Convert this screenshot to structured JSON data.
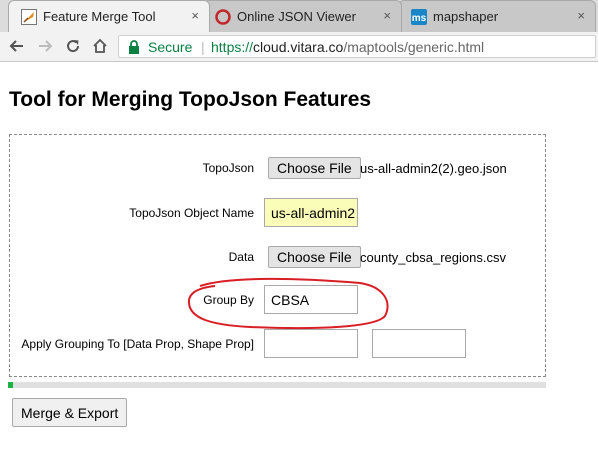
{
  "browser": {
    "tabs": [
      {
        "title": "Feature Merge Tool",
        "icon": "tool-favicon",
        "close": "×"
      },
      {
        "title": "Online JSON Viewer",
        "icon": "json-viewer-favicon",
        "close": "×"
      },
      {
        "title": "mapshaper",
        "icon": "mapshaper-favicon",
        "close": "×"
      }
    ],
    "address": {
      "secure_label": "Secure",
      "separator": "|",
      "scheme": "https://",
      "host": "cloud.vitara.co",
      "path": "/maptools/generic.html"
    }
  },
  "page": {
    "title": "Tool for Merging TopoJson Features",
    "form": {
      "topojson": {
        "label": "TopoJson",
        "button": "Choose File",
        "file": "us-all-admin2(2).geo.json"
      },
      "object_name": {
        "label": "TopoJson Object Name",
        "value": "us-all-admin2"
      },
      "data": {
        "label": "Data",
        "button": "Choose File",
        "file": "county_cbsa_regions.csv"
      },
      "group_by": {
        "label": "Group By",
        "value": "CBSA"
      },
      "apply_grouping": {
        "label": "Apply Grouping To [Data Prop, Shape Prop]",
        "data_prop": "",
        "shape_prop": ""
      }
    },
    "progress": 0.01,
    "merge_button": "Merge & Export"
  },
  "colors": {
    "secure_green": "#0b8043",
    "progress_green": "#1db344",
    "autofill_yellow": "#fafdb8",
    "annotation_red": "#d81f26"
  }
}
